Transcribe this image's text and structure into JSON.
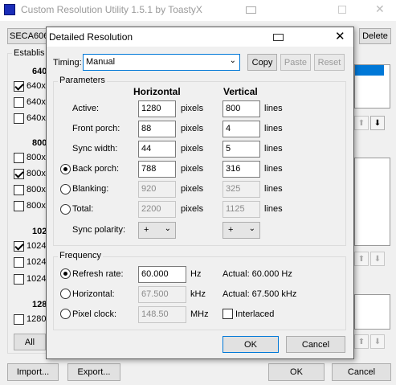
{
  "back_window": {
    "title": "Custom Resolution Utility 1.5.1 by ToastyX",
    "monitor_select": "SECA606",
    "delete_label": "Delete",
    "established_label": "Establis",
    "group_640": "640",
    "rows_640": [
      "640x",
      "640x",
      "640x"
    ],
    "group_800": "800",
    "rows_800": [
      "800x",
      "800x",
      "800x",
      "800x"
    ],
    "group_1024": "102",
    "rows_1024": [
      "1024",
      "1024",
      "1024"
    ],
    "group_1280": "128",
    "rows_1280": [
      "1280"
    ],
    "all_label": "All",
    "import_label": "Import...",
    "export_label": "Export...",
    "ok_label": "OK",
    "cancel_label": "Cancel"
  },
  "dialog": {
    "title": "Detailed Resolution",
    "timing_label": "Timing:",
    "timing_value": "Manual",
    "copy_label": "Copy",
    "paste_label": "Paste",
    "reset_label": "Reset",
    "parameters_label": "Parameters",
    "horizontal_header": "Horizontal",
    "vertical_header": "Vertical",
    "rows": [
      {
        "label": "Active:",
        "h": "1280",
        "h_unit": "pixels",
        "v": "800",
        "v_unit": "lines"
      },
      {
        "label": "Front porch:",
        "h": "88",
        "h_unit": "pixels",
        "v": "4",
        "v_unit": "lines"
      },
      {
        "label": "Sync width:",
        "h": "44",
        "h_unit": "pixels",
        "v": "5",
        "v_unit": "lines"
      },
      {
        "label": "Back porch:",
        "h": "788",
        "h_unit": "pixels",
        "v": "316",
        "v_unit": "lines"
      },
      {
        "label": "Blanking:",
        "h": "920",
        "h_unit": "pixels",
        "v": "325",
        "v_unit": "lines"
      },
      {
        "label": "Total:",
        "h": "2200",
        "h_unit": "pixels",
        "v": "1125",
        "v_unit": "lines"
      }
    ],
    "sync_polarity_label": "Sync polarity:",
    "h_polarity": "+",
    "v_polarity": "+",
    "frequency_label": "Frequency",
    "refresh_label": "Refresh rate:",
    "refresh_value": "60.000",
    "refresh_unit": "Hz",
    "refresh_actual": "Actual: 60.000 Hz",
    "horizontal_label": "Horizontal:",
    "horizontal_value": "67.500",
    "horizontal_unit": "kHz",
    "horizontal_actual": "Actual: 67.500 kHz",
    "pixel_clock_label": "Pixel clock:",
    "pixel_clock_value": "148.50",
    "pixel_clock_unit": "MHz",
    "interlaced_label": "Interlaced",
    "ok_label": "OK",
    "cancel_label": "Cancel"
  }
}
